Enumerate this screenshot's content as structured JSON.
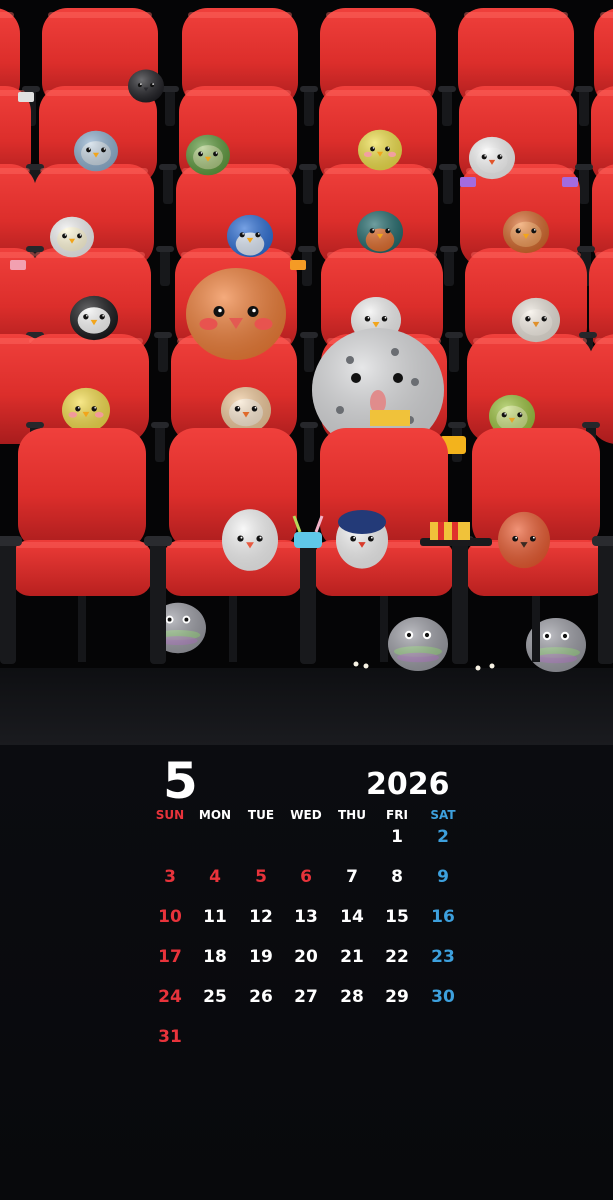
{
  "month": "5",
  "year": "2026",
  "weekdays": [
    "SUN",
    "MON",
    "TUE",
    "WED",
    "THU",
    "FRI",
    "SAT"
  ],
  "first_weekday_index": 5,
  "days_in_month": 31,
  "colors": {
    "sunday": "#e8333b",
    "saturday": "#3da0dd",
    "weekday": "#ffffff",
    "holiday": "#e8333b",
    "seat_red": "#e2312e",
    "background": "#08090c"
  },
  "holidays": [
    3,
    4,
    5,
    6
  ],
  "scene_icons": [
    "movie-theater-seats",
    "round-bird-audience",
    "pigeon-icon",
    "popcorn-icon",
    "drink-cup-icon"
  ]
}
